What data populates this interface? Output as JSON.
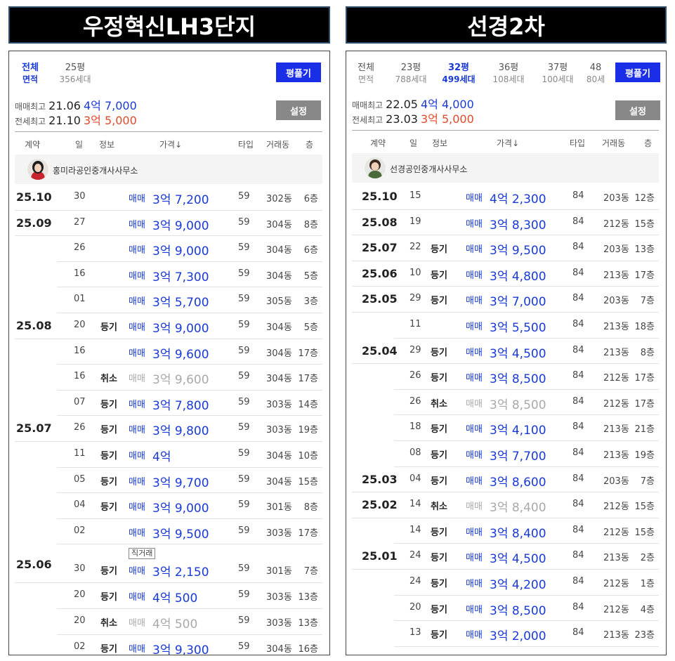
{
  "left": {
    "title": "우정혁신LH3단지",
    "area_tabs": [
      {
        "area": "전체",
        "sub": "면적",
        "selected": true
      },
      {
        "area": "25평",
        "sub": "356세대",
        "selected": false
      }
    ],
    "pyeong_button": "평풀기",
    "settings_button": "설정",
    "sale_max": {
      "label": "매매최고",
      "date": "21.06",
      "price": "4억 7,000"
    },
    "jeonse_max": {
      "label": "전세최고",
      "date": "21.10",
      "price": "3억 5,000"
    },
    "headers": [
      "계약",
      "일",
      "정보",
      "가격↓",
      "타입",
      "거래동",
      "층"
    ],
    "agent": "홍미라공인중개사사무소",
    "rows": [
      {
        "date": "25.10",
        "day": "30",
        "info": "",
        "kind": "매매",
        "price": "3억 7,200",
        "type": "59",
        "bldg": "302동",
        "floor": "6층",
        "cancel": false,
        "direct": ""
      },
      {
        "date": "25.09",
        "day": "27",
        "info": "",
        "kind": "매매",
        "price": "3억 9,000",
        "type": "59",
        "bldg": "304동",
        "floor": "8층",
        "cancel": false,
        "direct": ""
      },
      {
        "date": "",
        "day": "26",
        "info": "",
        "kind": "매매",
        "price": "3억 9,000",
        "type": "59",
        "bldg": "304동",
        "floor": "6층",
        "cancel": false,
        "direct": ""
      },
      {
        "date": "",
        "day": "16",
        "info": "",
        "kind": "매매",
        "price": "3억 7,300",
        "type": "59",
        "bldg": "304동",
        "floor": "5층",
        "cancel": false,
        "direct": ""
      },
      {
        "date": "",
        "day": "01",
        "info": "",
        "kind": "매매",
        "price": "3억 5,700",
        "type": "59",
        "bldg": "305동",
        "floor": "3층",
        "cancel": false,
        "direct": ""
      },
      {
        "date": "25.08",
        "day": "20",
        "info": "등기",
        "kind": "매매",
        "price": "3억 9,000",
        "type": "59",
        "bldg": "304동",
        "floor": "5층",
        "cancel": false,
        "direct": ""
      },
      {
        "date": "",
        "day": "16",
        "info": "",
        "kind": "매매",
        "price": "3억 9,600",
        "type": "59",
        "bldg": "304동",
        "floor": "17층",
        "cancel": false,
        "direct": ""
      },
      {
        "date": "",
        "day": "16",
        "info": "취소",
        "kind": "매매",
        "price": "3억 9,600",
        "type": "59",
        "bldg": "304동",
        "floor": "17층",
        "cancel": true,
        "direct": ""
      },
      {
        "date": "",
        "day": "07",
        "info": "등기",
        "kind": "매매",
        "price": "3억 7,800",
        "type": "59",
        "bldg": "303동",
        "floor": "14층",
        "cancel": false,
        "direct": ""
      },
      {
        "date": "25.07",
        "day": "26",
        "info": "등기",
        "kind": "매매",
        "price": "3억 9,800",
        "type": "59",
        "bldg": "303동",
        "floor": "19층",
        "cancel": false,
        "direct": ""
      },
      {
        "date": "",
        "day": "11",
        "info": "등기",
        "kind": "매매",
        "price": "4억",
        "type": "59",
        "bldg": "304동",
        "floor": "10층",
        "cancel": false,
        "direct": ""
      },
      {
        "date": "",
        "day": "05",
        "info": "등기",
        "kind": "매매",
        "price": "3억 9,700",
        "type": "59",
        "bldg": "304동",
        "floor": "15층",
        "cancel": false,
        "direct": ""
      },
      {
        "date": "",
        "day": "04",
        "info": "등기",
        "kind": "매매",
        "price": "3억 9,000",
        "type": "59",
        "bldg": "301동",
        "floor": "8층",
        "cancel": false,
        "direct": ""
      },
      {
        "date": "",
        "day": "02",
        "info": "",
        "kind": "매매",
        "price": "3억 9,500",
        "type": "59",
        "bldg": "303동",
        "floor": "17층",
        "cancel": false,
        "direct": ""
      },
      {
        "date": "25.06",
        "day": "30",
        "info": "등기",
        "kind": "매매",
        "price": "3억 2,150",
        "type": "59",
        "bldg": "301동",
        "floor": "7층",
        "cancel": false,
        "direct": "직거래"
      },
      {
        "date": "",
        "day": "20",
        "info": "등기",
        "kind": "매매",
        "price": "4억 500",
        "type": "59",
        "bldg": "303동",
        "floor": "13층",
        "cancel": false,
        "direct": ""
      },
      {
        "date": "",
        "day": "20",
        "info": "취소",
        "kind": "매매",
        "price": "4억 500",
        "type": "59",
        "bldg": "303동",
        "floor": "13층",
        "cancel": true,
        "direct": ""
      },
      {
        "date": "",
        "day": "02",
        "info": "등기",
        "kind": "매매",
        "price": "3억 9,300",
        "type": "59",
        "bldg": "304동",
        "floor": "16층",
        "cancel": false,
        "direct": ""
      }
    ]
  },
  "right": {
    "title": "선경2차",
    "area_tabs": [
      {
        "area": "전체",
        "sub": "면적",
        "selected": false
      },
      {
        "area": "23평",
        "sub": "788세대",
        "selected": false
      },
      {
        "area": "32평",
        "sub": "499세대",
        "selected": true
      },
      {
        "area": "36평",
        "sub": "108세대",
        "selected": false
      },
      {
        "area": "37평",
        "sub": "100세대",
        "selected": false
      },
      {
        "area": "48",
        "sub": "80세",
        "selected": false
      }
    ],
    "pyeong_button": "평풀기",
    "settings_button": "설정",
    "sale_max": {
      "label": "매매최고",
      "date": "22.05",
      "price": "4억 4,000"
    },
    "jeonse_max": {
      "label": "전세최고",
      "date": "23.03",
      "price": "3억 5,000"
    },
    "headers": [
      "계약",
      "일",
      "정보",
      "가격↓",
      "타입",
      "거래동",
      "층"
    ],
    "agent": "선경공인중개사사무소",
    "rows": [
      {
        "date": "25.10",
        "day": "15",
        "info": "",
        "kind": "매매",
        "price": "4억 2,300",
        "type": "84",
        "bldg": "203동",
        "floor": "12층",
        "cancel": false,
        "direct": ""
      },
      {
        "date": "25.08",
        "day": "19",
        "info": "",
        "kind": "매매",
        "price": "3억 8,300",
        "type": "84",
        "bldg": "212동",
        "floor": "15층",
        "cancel": false,
        "direct": ""
      },
      {
        "date": "25.07",
        "day": "22",
        "info": "등기",
        "kind": "매매",
        "price": "3억 9,500",
        "type": "84",
        "bldg": "203동",
        "floor": "13층",
        "cancel": false,
        "direct": ""
      },
      {
        "date": "25.06",
        "day": "10",
        "info": "등기",
        "kind": "매매",
        "price": "3억 4,800",
        "type": "84",
        "bldg": "213동",
        "floor": "17층",
        "cancel": false,
        "direct": ""
      },
      {
        "date": "25.05",
        "day": "29",
        "info": "등기",
        "kind": "매매",
        "price": "3억 7,000",
        "type": "84",
        "bldg": "203동",
        "floor": "7층",
        "cancel": false,
        "direct": ""
      },
      {
        "date": "",
        "day": "11",
        "info": "",
        "kind": "매매",
        "price": "3억 5,500",
        "type": "84",
        "bldg": "213동",
        "floor": "18층",
        "cancel": false,
        "direct": ""
      },
      {
        "date": "25.04",
        "day": "29",
        "info": "등기",
        "kind": "매매",
        "price": "3억 4,500",
        "type": "84",
        "bldg": "213동",
        "floor": "8층",
        "cancel": false,
        "direct": ""
      },
      {
        "date": "",
        "day": "26",
        "info": "등기",
        "kind": "매매",
        "price": "3억 8,500",
        "type": "84",
        "bldg": "212동",
        "floor": "17층",
        "cancel": false,
        "direct": ""
      },
      {
        "date": "",
        "day": "26",
        "info": "취소",
        "kind": "매매",
        "price": "3억 8,500",
        "type": "84",
        "bldg": "212동",
        "floor": "17층",
        "cancel": true,
        "direct": ""
      },
      {
        "date": "",
        "day": "18",
        "info": "등기",
        "kind": "매매",
        "price": "3억 4,100",
        "type": "84",
        "bldg": "213동",
        "floor": "21층",
        "cancel": false,
        "direct": ""
      },
      {
        "date": "",
        "day": "08",
        "info": "등기",
        "kind": "매매",
        "price": "3억 7,700",
        "type": "84",
        "bldg": "213동",
        "floor": "19층",
        "cancel": false,
        "direct": ""
      },
      {
        "date": "25.03",
        "day": "04",
        "info": "등기",
        "kind": "매매",
        "price": "3억 8,600",
        "type": "84",
        "bldg": "203동",
        "floor": "7층",
        "cancel": false,
        "direct": ""
      },
      {
        "date": "25.02",
        "day": "14",
        "info": "취소",
        "kind": "매매",
        "price": "3억 8,400",
        "type": "84",
        "bldg": "212동",
        "floor": "15층",
        "cancel": true,
        "direct": ""
      },
      {
        "date": "",
        "day": "14",
        "info": "등기",
        "kind": "매매",
        "price": "3억 8,400",
        "type": "84",
        "bldg": "212동",
        "floor": "15층",
        "cancel": false,
        "direct": ""
      },
      {
        "date": "25.01",
        "day": "24",
        "info": "등기",
        "kind": "매매",
        "price": "3억 4,500",
        "type": "84",
        "bldg": "213동",
        "floor": "2층",
        "cancel": false,
        "direct": ""
      },
      {
        "date": "",
        "day": "24",
        "info": "등기",
        "kind": "매매",
        "price": "3억 4,200",
        "type": "84",
        "bldg": "212동",
        "floor": "1층",
        "cancel": false,
        "direct": ""
      },
      {
        "date": "",
        "day": "20",
        "info": "등기",
        "kind": "매매",
        "price": "3억 8,500",
        "type": "84",
        "bldg": "212동",
        "floor": "4층",
        "cancel": false,
        "direct": ""
      },
      {
        "date": "",
        "day": "13",
        "info": "등기",
        "kind": "매매",
        "price": "3억 2,000",
        "type": "84",
        "bldg": "213동",
        "floor": "23층",
        "cancel": false,
        "direct": ""
      }
    ]
  }
}
